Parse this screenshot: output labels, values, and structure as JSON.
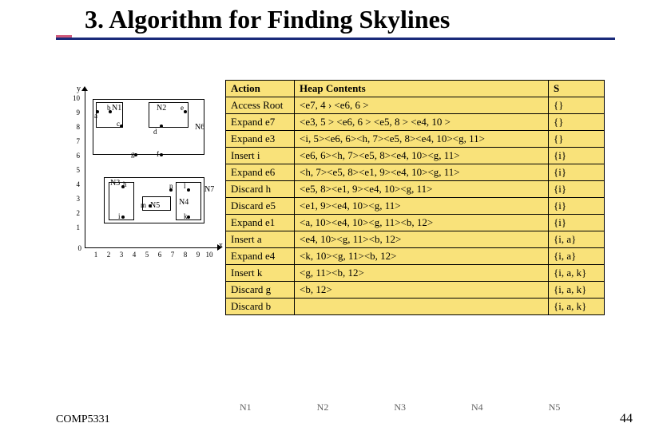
{
  "title": "3. Algorithm for Finding Skylines",
  "axes": {
    "y": "y",
    "x": "x"
  },
  "ticks": {
    "y": [
      "10",
      "9",
      "8",
      "7",
      "6",
      "5",
      "4",
      "3",
      "2",
      "1"
    ],
    "x": [
      "1",
      "2",
      "3",
      "4",
      "5",
      "6",
      "7",
      "8",
      "9",
      "10"
    ]
  },
  "points": {
    "a": "a",
    "b": "b",
    "c": "c",
    "d": "d",
    "e": "e",
    "f": "f",
    "g": "g",
    "h": "h",
    "i": "i",
    "k": "k",
    "l": "l",
    "m": "m",
    "n": "n"
  },
  "nodes": {
    "N1": "N1",
    "N2": "N2",
    "N3": "N3",
    "N4": "N4",
    "N5": "N5",
    "N6": "N6",
    "N7": "N7"
  },
  "headers": {
    "action": "Action",
    "heap": "Heap Contents",
    "s": "S"
  },
  "rows": [
    {
      "action": "Access Root",
      "heap": "<e7, 4 › <e6, 6 >",
      "s": "{}",
      "hl": true
    },
    {
      "action": "Expand e7",
      "heap": "<e3, 5 > <e6, 6 > <e5, 8 > <e4, 10 >",
      "s": "{}",
      "hl": true
    },
    {
      "action": "Expand e3",
      "heap": "<i, 5><e6, 6><h, 7><e5, 8><e4, 10><g, 11>",
      "s": "{}",
      "hl": true
    },
    {
      "action": "Insert i",
      "heap": "<e6, 6><h, 7><e5, 8><e4, 10><g, 11>",
      "s": "{i}",
      "hl": true
    },
    {
      "action": "Expand e6",
      "heap": "<h, 7><e5, 8><e1, 9><e4, 10><g, 11>",
      "s": "{i}",
      "hl": true
    },
    {
      "action": "Discard h",
      "heap": "<e5, 8><e1, 9><e4, 10><g, 11>",
      "s": "{i}",
      "hl": true
    },
    {
      "action": "Discard e5",
      "heap": "<e1, 9><e4, 10><g, 11>",
      "s": "{i}",
      "hl": true
    },
    {
      "action": "Expand e1",
      "heap": "<a, 10><e4, 10><g, 11><b, 12>",
      "s": "{i}",
      "hl": true
    },
    {
      "action": "Insert a",
      "heap": "<e4, 10><g, 11><b, 12>",
      "s": "{i, a}",
      "hl": true
    },
    {
      "action": "Expand e4",
      "heap": "<k, 10><g, 11><b, 12>",
      "s": "{i, a}",
      "hl": true
    },
    {
      "action": "Insert k",
      "heap": "<g, 11><b, 12>",
      "s": "{i, a, k}",
      "hl": true
    },
    {
      "action": "Discard g",
      "heap": "<b, 12>",
      "s": "{i, a, k}",
      "hl": true
    },
    {
      "action": "Discard b",
      "heap": "",
      "s": "{i, a, k}",
      "hl": true
    }
  ],
  "footer": {
    "left": "COMP5331",
    "right": "44",
    "nodes": [
      "N1",
      "N2",
      "N3",
      "N4",
      "N5"
    ]
  },
  "origin": "0",
  "chart_data": {
    "type": "scatter",
    "xlabel": "x",
    "ylabel": "y",
    "xlim": [
      0,
      10
    ],
    "ylim": [
      0,
      10
    ],
    "points": [
      {
        "id": "a",
        "x": 1,
        "y": 9
      },
      {
        "id": "b",
        "x": 2,
        "y": 9
      },
      {
        "id": "c",
        "x": 3,
        "y": 8
      },
      {
        "id": "d",
        "x": 6,
        "y": 8
      },
      {
        "id": "e",
        "x": 8,
        "y": 9
      },
      {
        "id": "f",
        "x": 6,
        "y": 6
      },
      {
        "id": "g",
        "x": 4,
        "y": 6
      },
      {
        "id": "h",
        "x": 3,
        "y": 4
      },
      {
        "id": "i",
        "x": 3,
        "y": 2
      },
      {
        "id": "m",
        "x": 5,
        "y": 3
      },
      {
        "id": "n",
        "x": 7,
        "y": 4
      },
      {
        "id": "l",
        "x": 8,
        "y": 4
      },
      {
        "id": "k",
        "x": 8,
        "y": 2
      }
    ],
    "rects": [
      {
        "id": "N1",
        "x": [
          1,
          3
        ],
        "y": [
          8,
          10
        ]
      },
      {
        "id": "N2",
        "x": [
          5,
          8
        ],
        "y": [
          8,
          10
        ]
      },
      {
        "id": "N3",
        "x": [
          2,
          4
        ],
        "y": [
          2,
          5
        ]
      },
      {
        "id": "N4",
        "x": [
          7,
          9
        ],
        "y": [
          2,
          5
        ]
      },
      {
        "id": "N5",
        "x": [
          5,
          7
        ],
        "y": [
          3,
          4
        ]
      },
      {
        "id": "N6",
        "x": [
          1,
          9
        ],
        "y": [
          6,
          10
        ]
      },
      {
        "id": "N7",
        "x": [
          2,
          9
        ],
        "y": [
          2,
          5
        ]
      }
    ]
  }
}
